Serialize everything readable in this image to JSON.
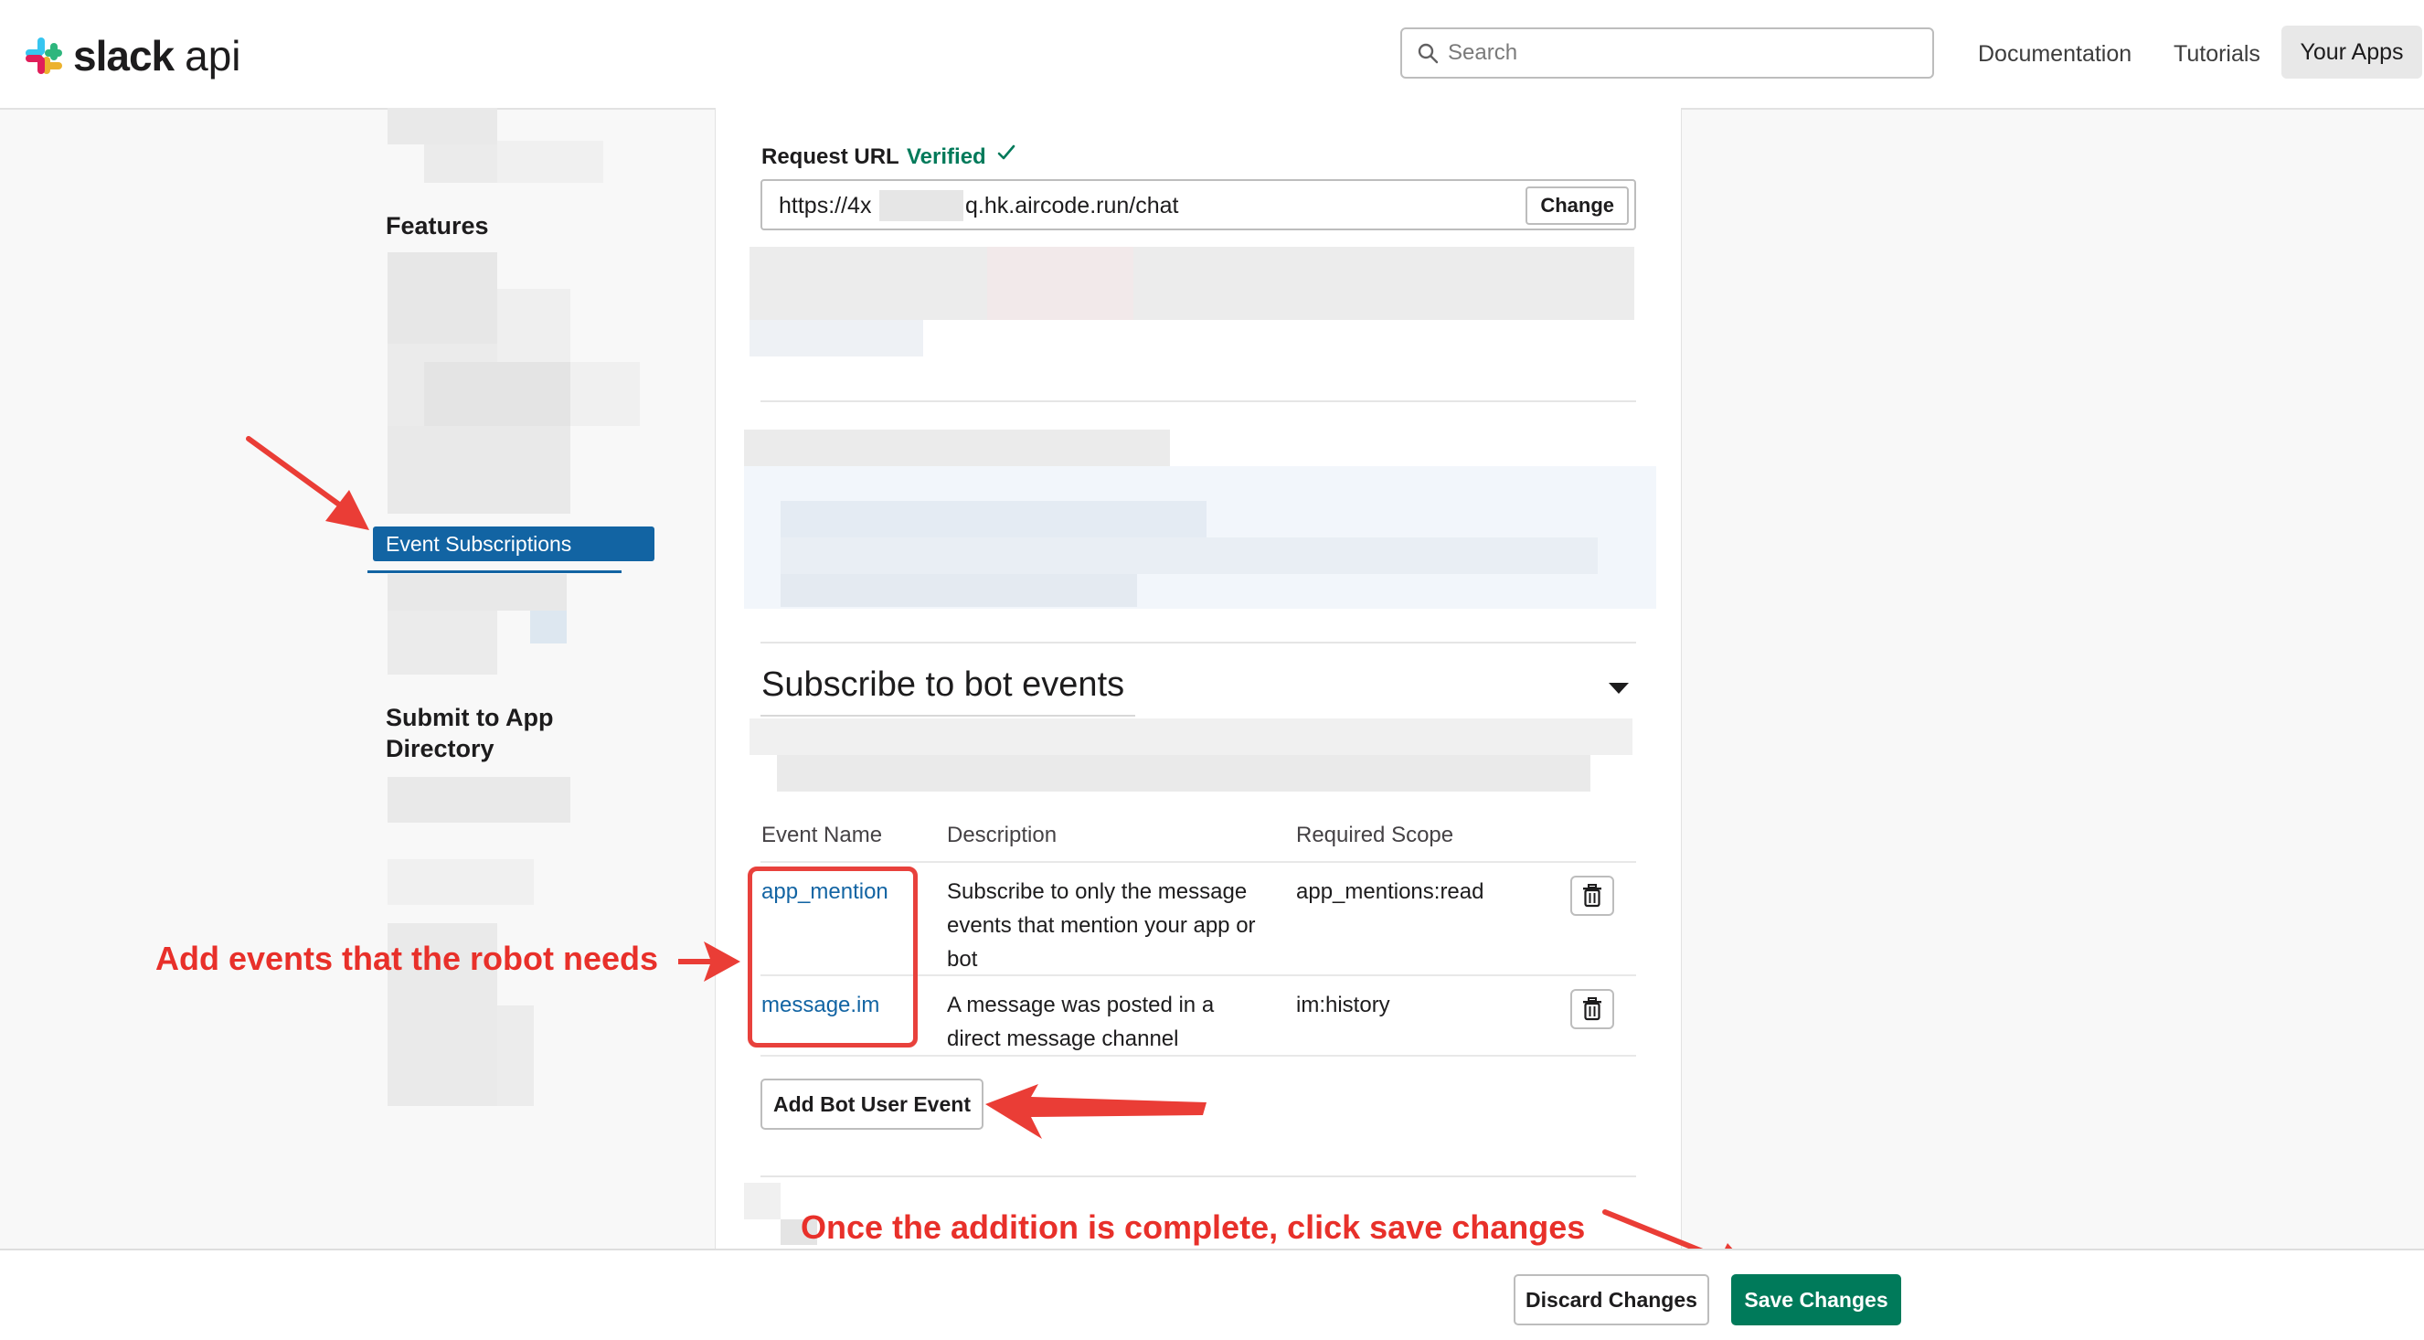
{
  "header": {
    "logo_word": "slack",
    "logo_suffix": "api",
    "search_placeholder": "Search",
    "nav": {
      "documentation": "Documentation",
      "tutorials": "Tutorials",
      "your_apps": "Your Apps"
    }
  },
  "sidebar": {
    "features_heading": "Features",
    "active_item": "Event Subscriptions",
    "submit_heading": "Submit to App Directory"
  },
  "request_url": {
    "label": "Request URL",
    "status": "Verified",
    "url_prefix": "https://4x",
    "url_suffix": "q.hk.aircode.run/chat",
    "change_label": "Change"
  },
  "bot_events": {
    "title": "Subscribe to bot events",
    "columns": [
      "Event Name",
      "Description",
      "Required Scope"
    ],
    "rows": [
      {
        "event": "app_mention",
        "description": "Subscribe to only the message events that mention your app or bot",
        "scope": "app_mentions:read"
      },
      {
        "event": "message.im",
        "description": "A message was posted in a direct message channel",
        "scope": "im:history"
      }
    ],
    "add_label": "Add Bot User Event"
  },
  "annotations": {
    "add_events": "Add events that the robot needs",
    "save_hint": "Once the addition is complete, click save changes"
  },
  "footer": {
    "discard_label": "Discard Changes",
    "save_label": "Save Changes"
  },
  "colors": {
    "accent_blue": "#1264a3",
    "save_green": "#007a5a",
    "annotation_red": "#e8302a"
  }
}
